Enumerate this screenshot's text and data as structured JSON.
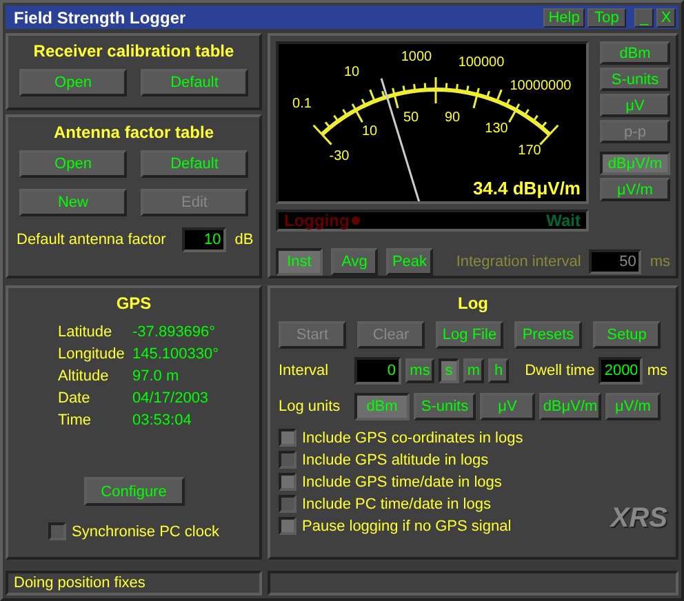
{
  "window": {
    "title": "Field Strength Logger",
    "buttons": [
      {
        "kind": "text",
        "label": "Help"
      },
      {
        "kind": "text",
        "label": "Top"
      },
      {
        "kind": "minimize",
        "label": "_"
      },
      {
        "kind": "close",
        "label": "X"
      }
    ]
  },
  "receiver_calibration": {
    "title": "Receiver calibration table",
    "buttons": [
      {
        "label": "Open",
        "disabled": false
      },
      {
        "label": "Default",
        "disabled": false
      }
    ]
  },
  "antenna_factor": {
    "title": "Antenna factor table",
    "buttons": [
      {
        "label": "Open",
        "disabled": false
      },
      {
        "label": "Default",
        "disabled": false
      },
      {
        "label": "New",
        "disabled": false
      },
      {
        "label": "Edit",
        "disabled": true
      }
    ],
    "default_label": "Default antenna factor",
    "default_value": "10",
    "unit": "dB"
  },
  "gps": {
    "title": "GPS",
    "fields": [
      {
        "label": "Latitude",
        "value": "-37.893696°"
      },
      {
        "label": "Longitude",
        "value": "145.100330°"
      },
      {
        "label": "Altitude",
        "value": "97.0 m"
      },
      {
        "label": "Date",
        "value": "04/17/2003"
      },
      {
        "label": "Time",
        "value": "03:53:04"
      }
    ],
    "configure": "Configure",
    "sync": {
      "label": "Synchronise PC clock",
      "checked": false
    }
  },
  "meter": {
    "outer_scale": [
      "0.1",
      "10",
      "1000",
      "100000",
      "10000000"
    ],
    "inner_scale": [
      "-30",
      "10",
      "50",
      "90",
      "130",
      "170"
    ],
    "reading": "34.4 dBμV/m"
  },
  "units": [
    {
      "label": "dBm",
      "selected": false,
      "disabled": false
    },
    {
      "label": "S-units",
      "selected": false,
      "disabled": false
    },
    {
      "label": "μV",
      "selected": false,
      "disabled": false
    },
    {
      "label": "p-p",
      "selected": false,
      "disabled": true
    },
    {
      "label": "dBμV/m",
      "selected": true,
      "disabled": false
    },
    {
      "label": "μV/m",
      "selected": false,
      "disabled": false
    }
  ],
  "status": {
    "logging": "Logging",
    "logging_on": false,
    "wait": "Wait",
    "wait_on": false
  },
  "modes": [
    {
      "label": "Inst",
      "selected": true
    },
    {
      "label": "Avg",
      "selected": false
    },
    {
      "label": "Peak",
      "selected": false
    }
  ],
  "integration": {
    "label": "Integration interval",
    "value": "50",
    "unit": "ms",
    "disabled": true
  },
  "log": {
    "title": "Log",
    "buttons": [
      {
        "label": "Start",
        "disabled": true
      },
      {
        "label": "Clear",
        "disabled": true
      },
      {
        "label": "Log File",
        "disabled": false
      },
      {
        "label": "Presets",
        "disabled": false
      },
      {
        "label": "Setup",
        "disabled": false
      }
    ],
    "interval_label": "Interval",
    "interval_value": "0",
    "interval_units": [
      {
        "label": "ms",
        "selected": false
      },
      {
        "label": "s",
        "selected": true
      },
      {
        "label": "m",
        "selected": false
      },
      {
        "label": "h",
        "selected": false
      }
    ],
    "dwell_label": "Dwell time",
    "dwell_value": "2000",
    "dwell_unit": "ms",
    "units_label": "Log units",
    "units": [
      {
        "label": "dBm",
        "selected": true
      },
      {
        "label": "S-units",
        "selected": false
      },
      {
        "label": "μV",
        "selected": false
      },
      {
        "label": "dBμV/m",
        "selected": false
      },
      {
        "label": "μV/m",
        "selected": false
      }
    ],
    "options": [
      {
        "label": "Include GPS co-ordinates in logs",
        "checked": true
      },
      {
        "label": "Include GPS altitude in logs",
        "checked": false
      },
      {
        "label": "Include GPS time/date in logs",
        "checked": true
      },
      {
        "label": "Include PC time/date in logs",
        "checked": false
      },
      {
        "label": "Pause logging if no GPS signal",
        "checked": true
      }
    ],
    "logo": "XRS"
  },
  "status_bar": [
    "Doing position fixes"
  ]
}
